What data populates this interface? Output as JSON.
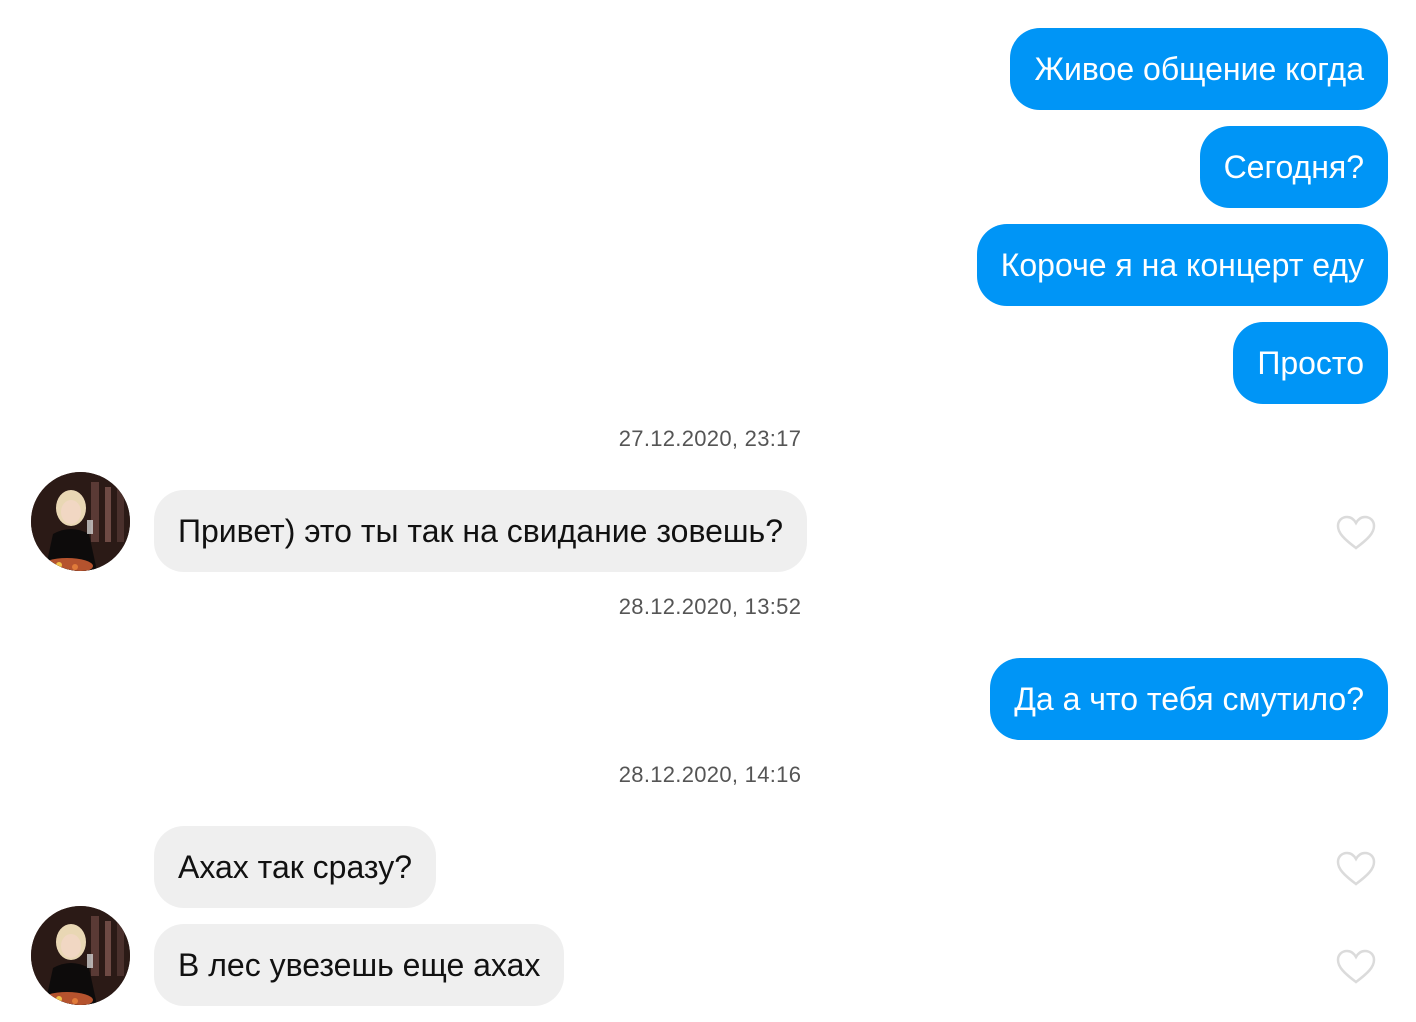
{
  "messages": {
    "out_1": "Живое общение когда",
    "out_2": "Сегодня?",
    "out_3": "Короче я на концерт еду",
    "out_4": "Просто",
    "in_1": "Привет) это ты так на свидание зовешь?",
    "out_5": "Да а что тебя смутило?",
    "in_2": "Ахах так сразу?",
    "in_3": "В лес увезешь еще ахах"
  },
  "timestamps": {
    "t1": "27.12.2020, 23:17",
    "t2": "28.12.2020, 13:52",
    "t3": "28.12.2020, 14:16"
  },
  "colors": {
    "outgoing_bubble": "#0095f6",
    "incoming_bubble": "#efefef",
    "heart_outline": "#dbdbdb"
  },
  "icons": {
    "like": "heart-outline-icon"
  }
}
